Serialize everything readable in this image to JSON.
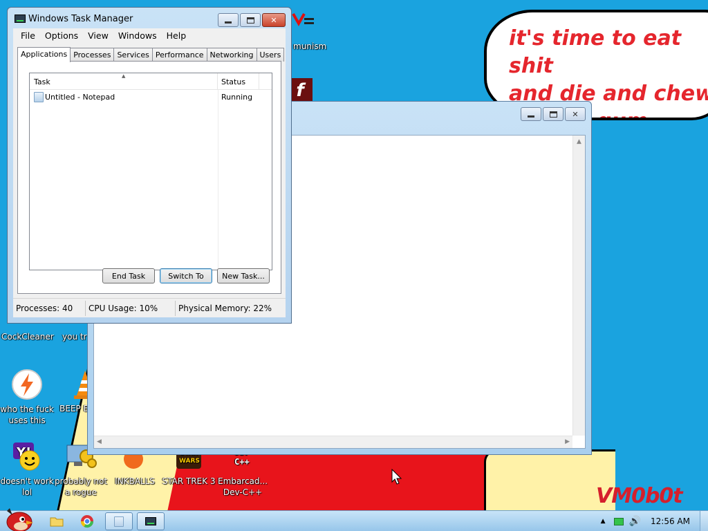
{
  "wallpaper": {
    "speech_text": "it's time to eat shit\nand die and chew\nbubble gum",
    "signature": "VM0b0t"
  },
  "desktop_icons": [
    {
      "label": "CockCleaner"
    },
    {
      "label_partial": "you tr"
    },
    {
      "label": "who the fuck uses this"
    },
    {
      "label_partial": "BEEP B"
    },
    {
      "label": "doesn't work lol"
    },
    {
      "label": "probably not a rogue"
    },
    {
      "label": "INKBALLS"
    },
    {
      "label": "STAR TREK 3"
    },
    {
      "label": "Embarcad... Dev-C++"
    },
    {
      "label_partial": "munism"
    }
  ],
  "task_manager": {
    "title": "Windows Task Manager",
    "menu": [
      "File",
      "Options",
      "View",
      "Windows",
      "Help"
    ],
    "tabs": [
      "Applications",
      "Processes",
      "Services",
      "Performance",
      "Networking",
      "Users"
    ],
    "active_tab": "Applications",
    "columns": [
      "Task",
      "Status"
    ],
    "rows": [
      {
        "task": "Untitled - Notepad",
        "status": "Running"
      }
    ],
    "buttons": {
      "end_task": "End Task",
      "switch_to": "Switch To",
      "new_task": "New Task..."
    },
    "status": {
      "processes": "Processes: 40",
      "cpu": "CPU Usage: 10%",
      "memory": "Physical Memory: 22%"
    }
  },
  "taskbar": {
    "clock": "12:56 AM"
  }
}
